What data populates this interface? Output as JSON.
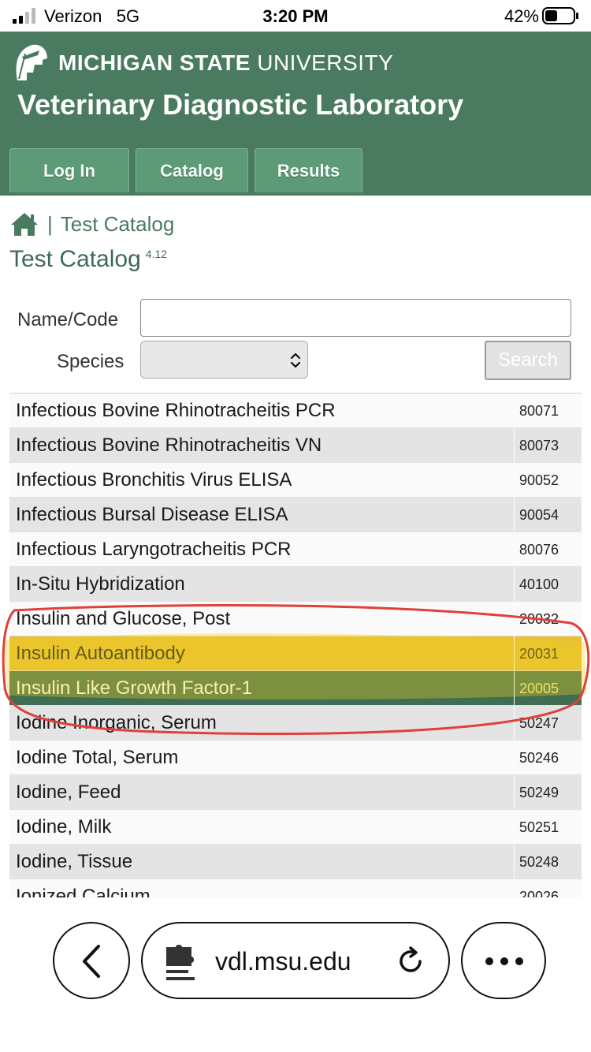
{
  "status_bar": {
    "carrier": "Verizon",
    "network": "5G",
    "time": "3:20 PM",
    "battery": "42%"
  },
  "header": {
    "university_bold": "MICHIGAN STATE",
    "university_light": "UNIVERSITY",
    "lab_name": "Veterinary Diagnostic Laboratory",
    "nav": [
      "Log In",
      "Catalog",
      "Results"
    ]
  },
  "breadcrumb": {
    "separator": "|",
    "current": "Test Catalog"
  },
  "page": {
    "title": "Test Catalog",
    "version": "4.12"
  },
  "search": {
    "name_label": "Name/Code",
    "name_value": "",
    "species_label": "Species",
    "species_value": "",
    "button": "Search"
  },
  "results": [
    {
      "name": "Infectious Bovine Rhinotracheitis PCR",
      "code": "80071",
      "state": "normal"
    },
    {
      "name": "Infectious Bovine Rhinotracheitis VN",
      "code": "80073",
      "state": "normal"
    },
    {
      "name": "Infectious Bronchitis Virus ELISA",
      "code": "90052",
      "state": "normal"
    },
    {
      "name": "Infectious Bursal Disease ELISA",
      "code": "90054",
      "state": "normal"
    },
    {
      "name": "Infectious Laryngotracheitis PCR",
      "code": "80076",
      "state": "normal"
    },
    {
      "name": "In-Situ Hybridization",
      "code": "40100",
      "state": "normal"
    },
    {
      "name": "Insulin and Glucose, Post",
      "code": "20032",
      "state": "normal"
    },
    {
      "name": "Insulin Autoantibody",
      "code": "20031",
      "state": "highlighted"
    },
    {
      "name": "Insulin Like Growth Factor-1",
      "code": "20005",
      "state": "selected"
    },
    {
      "name": "Iodine Inorganic, Serum",
      "code": "50247",
      "state": "normal"
    },
    {
      "name": "Iodine Total, Serum",
      "code": "50246",
      "state": "normal"
    },
    {
      "name": "Iodine, Feed",
      "code": "50249",
      "state": "normal"
    },
    {
      "name": "Iodine, Milk",
      "code": "50251",
      "state": "normal"
    },
    {
      "name": "Iodine, Tissue",
      "code": "50248",
      "state": "normal"
    },
    {
      "name": "Ionized Calcium",
      "code": "20026",
      "state": "normal"
    }
  ],
  "browser": {
    "url": "vdl.msu.edu"
  },
  "colors": {
    "brand_green": "#4a7a5f",
    "nav_button": "#5d9a78",
    "selected_row": "#3f6e54",
    "highlighter": "#e7c036",
    "annotation_red": "#e0403a"
  }
}
